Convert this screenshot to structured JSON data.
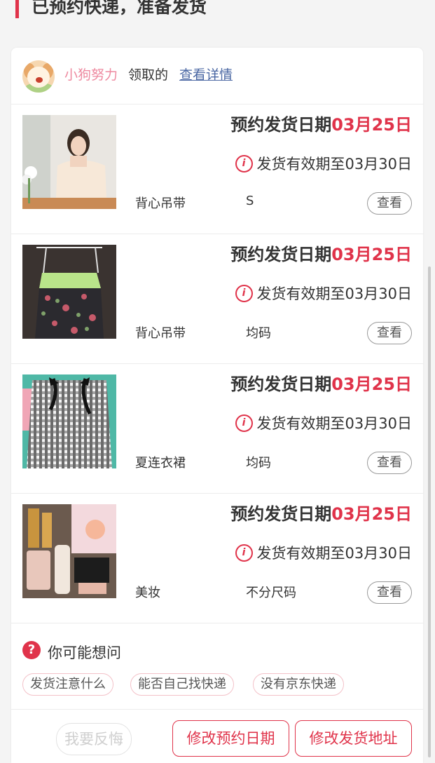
{
  "header": {
    "title": "已预约快递，准备发货"
  },
  "user": {
    "name": "小狗努力",
    "action": "领取的",
    "link": "查看详情"
  },
  "items": [
    {
      "date_label": "预约发货日期",
      "date_value": "03月25日",
      "valid_text": "发货有效期至03月30日",
      "name": "背心吊带",
      "size": "S",
      "view_label": "查看",
      "thumb": "woman-in-blouse"
    },
    {
      "date_label": "预约发货日期",
      "date_value": "03月25日",
      "valid_text": "发货有效期至03月30日",
      "name": "背心吊带",
      "size": "均码",
      "view_label": "查看",
      "thumb": "floral-camisole"
    },
    {
      "date_label": "预约发货日期",
      "date_value": "03月25日",
      "valid_text": "发货有效期至03月30日",
      "name": "夏连衣裙",
      "size": "均码",
      "view_label": "查看",
      "thumb": "gingham-dress"
    },
    {
      "date_label": "预约发货日期",
      "date_value": "03月25日",
      "valid_text": "发货有效期至03月30日",
      "name": "美妆",
      "size": "不分尺码",
      "view_label": "查看",
      "thumb": "cosmetics"
    }
  ],
  "faq": {
    "title": "你可能想问",
    "chips": [
      "发货注意什么",
      "能否自己找快递",
      "没有京东快递"
    ]
  },
  "actions": {
    "regret": "我要反悔",
    "change_date": "修改预约日期",
    "change_address": "修改发货地址"
  },
  "colors": {
    "accent": "#e0334a",
    "link": "#4a67a3",
    "username": "#ee8aa0"
  }
}
